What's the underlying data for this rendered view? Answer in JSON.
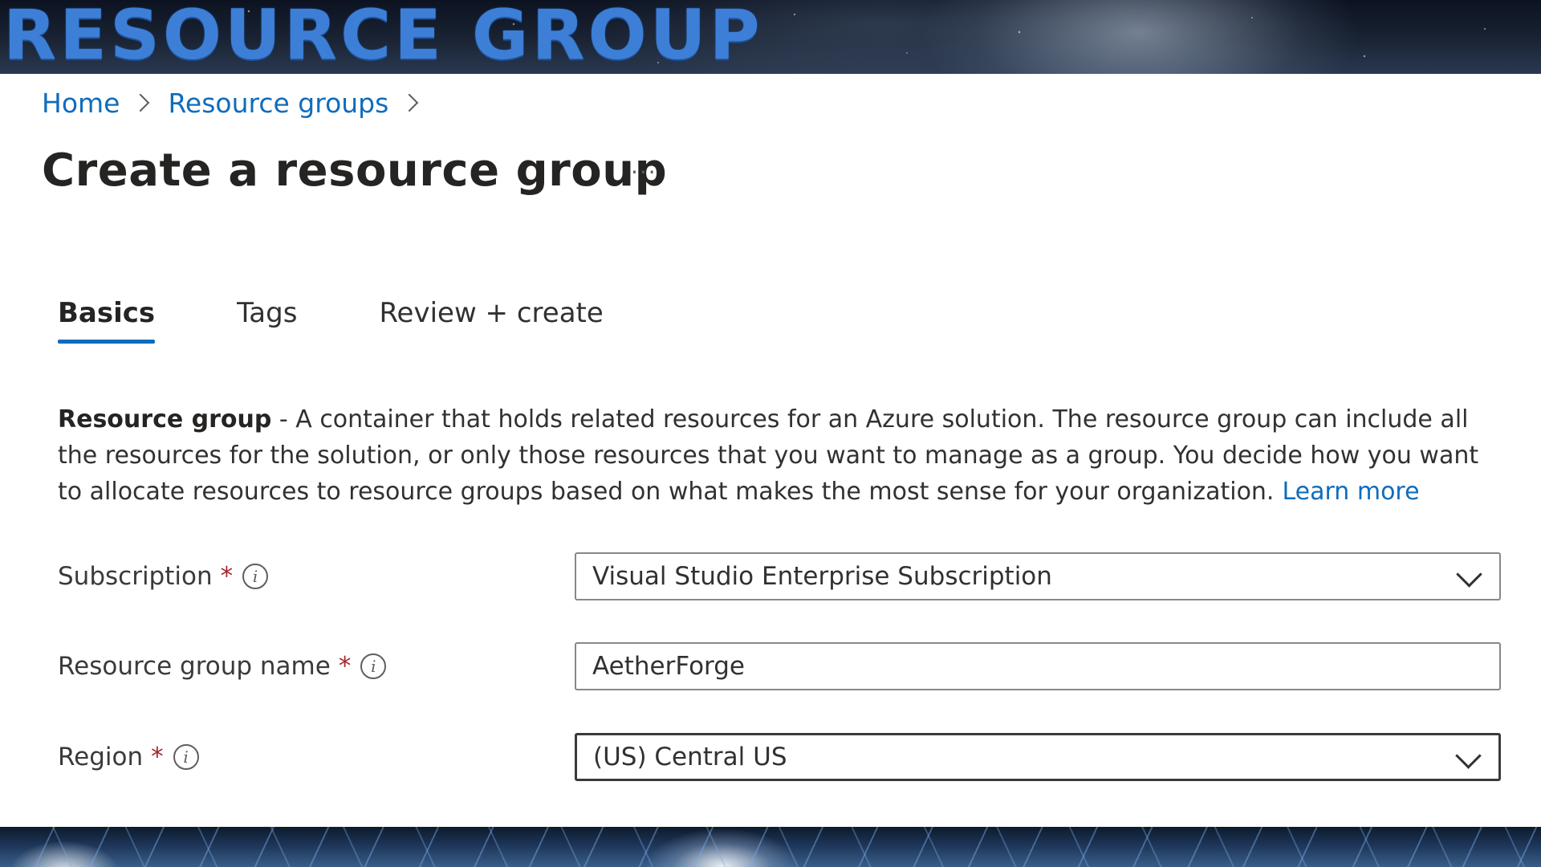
{
  "banner": {
    "title": "RESOURCE GROUP"
  },
  "breadcrumb": {
    "items": [
      "Home",
      "Resource groups"
    ]
  },
  "page": {
    "title": "Create a resource group",
    "more_label": "···"
  },
  "tabs": [
    {
      "label": "Basics",
      "active": true
    },
    {
      "label": "Tags",
      "active": false
    },
    {
      "label": "Review + create",
      "active": false
    }
  ],
  "description": {
    "term": "Resource group",
    "text": " - A container that holds related resources for an Azure solution. The resource group can include all the resources for the solution, or only those resources that you want to manage as a group. You decide how you want to allocate resources to resource groups based on what makes the most sense for your organization.",
    "link": "Learn more"
  },
  "form": {
    "subscription": {
      "label": "Subscription",
      "required": "*",
      "info": "i",
      "value": "Visual Studio Enterprise Subscription",
      "icon": "chevron-down-icon"
    },
    "resource_group_name": {
      "label": "Resource group name",
      "required": "*",
      "info": "i",
      "value": "AetherForge"
    },
    "region": {
      "label": "Region",
      "required": "*",
      "info": "i",
      "value": "(US) Central US",
      "icon": "chevron-down-icon"
    }
  },
  "colors": {
    "accent": "#0f6cbd",
    "required": "#a4262c",
    "banner_text": "#3d7fd6"
  }
}
